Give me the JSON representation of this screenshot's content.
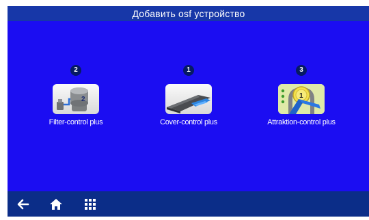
{
  "header": {
    "title": "Добавить osf устройство"
  },
  "devices": [
    {
      "badge": "2",
      "label": "Filter-control plus",
      "tile_number": "2",
      "icon": "filter-icon"
    },
    {
      "badge": "1",
      "label": "Cover-control plus",
      "icon": "cover-icon"
    },
    {
      "badge": "3",
      "label": "Attraktion-control plus",
      "tile_number": "1",
      "icon": "attraction-icon"
    }
  ],
  "nav": [
    {
      "icon": "back-arrow-icon"
    },
    {
      "icon": "home-icon"
    },
    {
      "icon": "grid-menu-icon"
    }
  ],
  "colors": {
    "background": "#1b0df2",
    "title_bar": "#1737a8",
    "bottom_bar": "#0b2d88",
    "badge": "#061a63"
  }
}
